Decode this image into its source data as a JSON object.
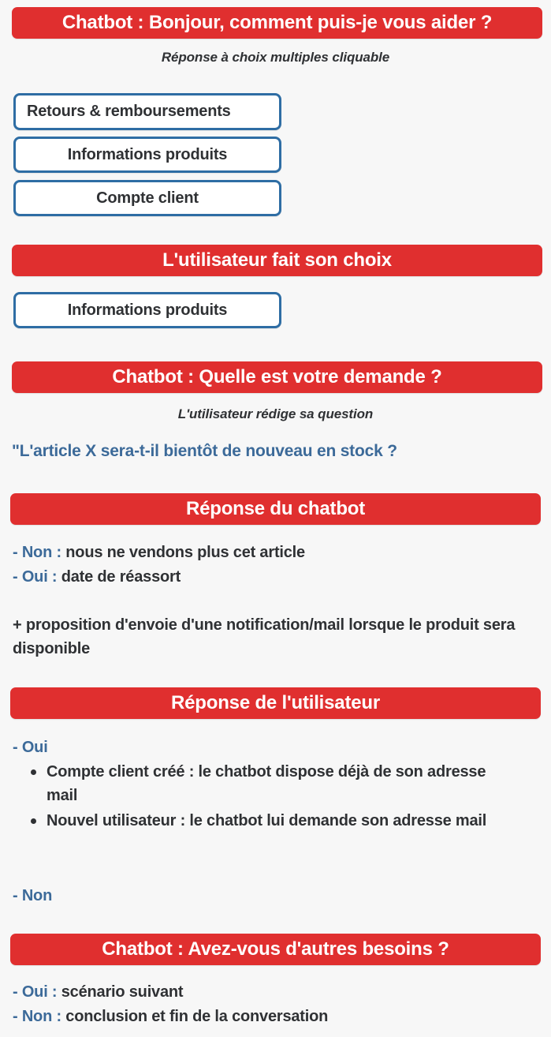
{
  "background_color": "#f7f7f7",
  "accent_red": "#e02f2f",
  "accent_blue": "#2e6da4",
  "text_blue": "#3c6a99",
  "text_dark": "#2f3134",
  "sections": {
    "greeting": {
      "banner": "Chatbot : Bonjour, comment puis-je vous aider ?",
      "caption": "Réponse à choix multiples cliquable",
      "choices": [
        "Retours & remboursements",
        "Informations produits",
        "Compte client"
      ]
    },
    "user_choice": {
      "banner": "L'utilisateur fait son choix",
      "selected": "Informations produits"
    },
    "request": {
      "banner": "Chatbot : Quelle est votre demande ?",
      "caption": "L'utilisateur rédige sa question",
      "quote": "\"L'article X sera-t-il bientôt de nouveau en stock ?"
    },
    "bot_answer": {
      "banner": "Réponse du chatbot",
      "lines": [
        {
          "key": "- Non :",
          "value": "nous ne vendons plus cet article"
        },
        {
          "key": "- Oui :",
          "value": "date de réassort"
        }
      ],
      "note": "+ proposition d'envoie d'une notification/mail lorsque le produit sera disponible"
    },
    "user_answer": {
      "banner": "Réponse de l'utilisateur",
      "yes_label": "- Oui",
      "yes_bullets": [
        "Compte client créé : le chatbot dispose déjà de son adresse mail",
        "Nouvel utilisateur : le chatbot lui demande son adresse mail"
      ],
      "no_label": "- Non"
    },
    "other_needs": {
      "banner": "Chatbot : Avez-vous d'autres besoins ?",
      "lines": [
        {
          "key": "- Oui :",
          "value": "scénario suivant"
        },
        {
          "key": "- Non :",
          "value": "conclusion et fin de la conversation"
        }
      ]
    }
  }
}
